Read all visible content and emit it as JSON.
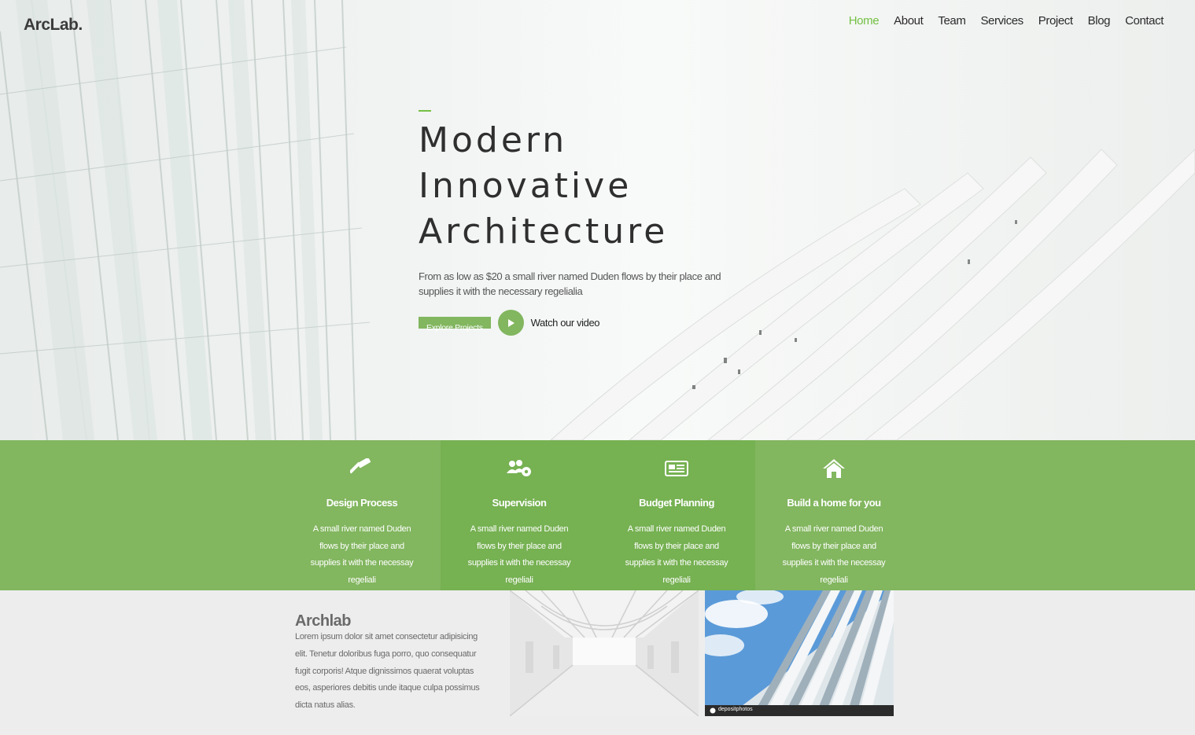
{
  "brand": "ArcLab.",
  "nav": {
    "items": [
      "Home",
      "About",
      "Team",
      "Services",
      "Project",
      "Blog",
      "Contact"
    ],
    "active": "Home"
  },
  "hero": {
    "headline": [
      "Modern",
      "Innovative",
      "Architecture"
    ],
    "lead": "From as low as $20 a small river named Duden flows by their place and supplies it with the necessary regelialia",
    "explore_label": "Explore Projects",
    "video_label": "Watch our video"
  },
  "services": [
    {
      "icon": "hammer-icon",
      "title": "Design Process",
      "desc": "A small river named Duden flows by their place and supplies it with the necessay regeliali"
    },
    {
      "icon": "team-gear-icon",
      "title": "Supervision",
      "desc": "A small river named Duden flows by their place and supplies it with the necessay regeliali"
    },
    {
      "icon": "newspaper-icon",
      "title": "Budget Planning",
      "desc": "A small river named Duden flows by their place and supplies it with the necessay regeliali"
    },
    {
      "icon": "home-icon",
      "title": "Build a home for you",
      "desc": "A small river named Duden flows by their place and supplies it with the necessay regeliali"
    }
  ],
  "about": {
    "title": "Archlab",
    "text": "Lorem ipsum dolor sit amet consectetur adipisicing elit. Tenetur doloribus fuga porro, quo consequatur fugit corporis! Atque dignissimos quaerat voluptas eos, asperiores debitis unde itaque culpa possimus dicta natus alias.",
    "image2_watermark": "depositphotos"
  },
  "colors": {
    "accent": "#74c043",
    "band": "#82b65f",
    "band_dark": "#76b152"
  }
}
